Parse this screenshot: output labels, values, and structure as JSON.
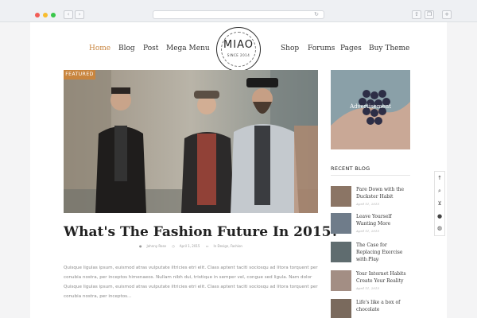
{
  "nav": {
    "left": [
      "Home",
      "Blog",
      "Post",
      "Mega Menu"
    ],
    "right": [
      "Shop",
      "Forums",
      "Pages",
      "Buy Theme"
    ]
  },
  "logo": {
    "text": "MIAO",
    "sub": "SINCE 2014"
  },
  "post": {
    "badge": "FEATURED",
    "title": "What's The Fashion Future In 2015?",
    "meta_author": "Johnny Rose",
    "meta_date": "April 1, 2015",
    "meta_category": "In Design, Fashion",
    "excerpt": "Quisque ligulas ipsum, euismod atras vulputate iltricies etri elit. Class aptent taciti sociosqu ad litora torquent per conubia nostra, per inceptos himenaeos. Nullam nibh dui, tristique in semper vel, congue sed ligula. Nam dolor Quisque ligulas ipsum, euismod atras vulputate iltricies etri elit. Class aptent taciti sociosqu ad litora torquent per conubia nostra, per inceptos..."
  },
  "sidebar": {
    "ad_label": "Advertisement",
    "recent_title": "RECENT BLOG",
    "recent": [
      {
        "title": "Pare Down with the Duckster Habit",
        "date": "April 11, 2015"
      },
      {
        "title": "Leave Yourself Wanting More",
        "date": "April 11, 2015"
      },
      {
        "title": "The Case for Replacing Exercise with Play",
        "date": "April 11, 2015"
      },
      {
        "title": "Your Internet Habits Create Your Reality",
        "date": "April 11, 2015"
      },
      {
        "title": "Life's like a box of chocolate",
        "date": "April 11, 2015"
      }
    ]
  },
  "colors": {
    "accent": "#c8853f",
    "text": "#222222",
    "muted": "#999999"
  },
  "icons": [
    "arrow-up-icon",
    "search-icon",
    "cart-icon",
    "user-icon",
    "globe-icon"
  ]
}
